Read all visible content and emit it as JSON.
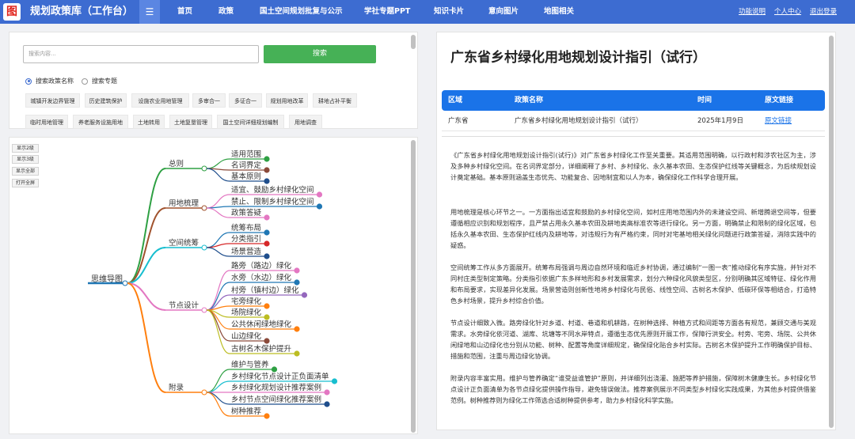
{
  "header": {
    "logo_glyph": "图",
    "app_title": "规划政策库（工作台）",
    "menu_glyph": "☰",
    "nav": [
      "首页",
      "政策",
      "国土空间规划批复与公示",
      "学社专题PPT",
      "知识卡片",
      "意向图片",
      "地图相关"
    ],
    "right_links": [
      "功能说明",
      "个人中心",
      "退出登录"
    ]
  },
  "search": {
    "placeholder": "搜索内容...",
    "button_label": "搜索",
    "radio_options": [
      "搜索政策名称",
      "搜索专题"
    ],
    "selected_radio": 0,
    "tags_row1": [
      "城镇开发边界管理",
      "历史建筑保护",
      "设施农业用地管理",
      "多审合一",
      "多证合一",
      "规划用地改革",
      "耕地占补平衡"
    ],
    "tags_row2": [
      "临时用地管理",
      "养老服务设施用地",
      "土地转用",
      "土地复垦管理",
      "国土空间详细规划编制",
      "用地调查"
    ]
  },
  "mindmap": {
    "controls": [
      "显示2级",
      "显示3级",
      "显示全部",
      "打开全屏"
    ],
    "root": "思维导图",
    "branches": [
      {
        "label": "总则",
        "color": "#2ea043",
        "children": [
          {
            "label": "适用范围",
            "color": "#2ea043"
          },
          {
            "label": "名词界定",
            "color": "#8b4a3a"
          },
          {
            "label": "基本原则",
            "color": "#1f4e8c"
          }
        ]
      },
      {
        "label": "用地梳理",
        "color": "#a0522d",
        "children": [
          {
            "label": "适宜、鼓励乡村绿化空间",
            "color": "#e377c2"
          },
          {
            "label": "禁止、限制乡村绿化空间",
            "color": "#1f77b4"
          },
          {
            "label": "政策答疑",
            "color": "#e377c2"
          }
        ]
      },
      {
        "label": "空间统筹",
        "color": "#17becf",
        "children": [
          {
            "label": "统筹布局",
            "color": "#1f77b4"
          },
          {
            "label": "分类指引",
            "color": "#d62728"
          },
          {
            "label": "场景营造",
            "color": "#1f4e8c"
          }
        ]
      },
      {
        "label": "节点设计",
        "color": "#e377c2",
        "children": [
          {
            "label": "路旁（路边）绿化",
            "color": "#e377c2"
          },
          {
            "label": "水旁（水边）绿化",
            "color": "#1f77b4"
          },
          {
            "label": "村旁（镇村边）绿化",
            "color": "#9467bd"
          },
          {
            "label": "宅旁绿化",
            "color": "#ff7f0e"
          },
          {
            "label": "场院绿化",
            "color": "#bcbd22"
          },
          {
            "label": "公共休闲绿地绿化",
            "color": "#ff7f0e"
          },
          {
            "label": "山边绿化",
            "color": "#8b4a3a"
          },
          {
            "label": "古树名木保护提升",
            "color": "#bcbd22"
          }
        ]
      },
      {
        "label": "附录",
        "color": "#ff7f0e",
        "children": [
          {
            "label": "维护与管养",
            "color": "#2ea043"
          },
          {
            "label": "乡村绿化节点设计正负面清单",
            "color": "#17becf"
          },
          {
            "label": "乡村绿化规划设计推荐案例",
            "color": "#e377c2"
          },
          {
            "label": "乡村节点空间绿化推荐案例",
            "color": "#1f4e8c"
          },
          {
            "label": "树种推荐",
            "color": "#ff7f0e"
          }
        ]
      }
    ]
  },
  "document": {
    "title": "广东省乡村绿化用地规划设计指引（试行）",
    "columns": [
      "区域",
      "政策名称",
      "时间",
      "原文链接"
    ],
    "row": {
      "region": "广东省",
      "name": "广东省乡村绿化用地规划设计指引（试行）",
      "date": "2025年1月9日",
      "link": "原文链接"
    },
    "paragraphs": [
      "《广东省乡村绿化用地规划设计指引(试行)》对广东省乡村绿化工作至关重要。其适用范围明确，以行政村和涉农社区为主，涉及多种乡村绿化空间。在名词界定部分，详细阐释了乡村、乡村绿化、永久基本农田、生态保护红线等关键概念，为后续规划设计奠定基础。基本原则涵盖生态优先、功能复合、因地制宜和以人为本，确保绿化工作科学合理开展。",
      "用地梳理是核心环节之一。一方面指出适宜和鼓励的乡村绿化空间，如村庄用地范围内外的未建设空间、新增腾退空间等，但要遵循相应识别和规划程序，且严禁占用永久基本农田及耕地类高标准农等进行绿化。另一方面，明确禁止和限制的绿化区域，包括永久基本农田、生态保护红线内及耕地等，对违规行为有严格约束，同时对宅基地相关绿化问题进行政策答疑，消除实践中的疑惑。",
      "空间统筹工作从多方面展开。统筹布局强调与周边自然环境和临近乡村协调，通过编制“一图一表”推动绿化有序实施，并针对不同村庄类型制定策略。分类指引依据广东多样地形和乡村发展需求，划分六种绿化风貌类型区，分别明确其区域特征、绿化作用和布局要求，实现差异化发展。场景营造则创新性地将乡村绿化与民俗、线性空间、古树名木保护、低碳环保等相结合，打造特色乡村场景，提升乡村综合价值。",
      "节点设计细致入微。路旁绿化针对乡道、村道、巷道和机耕路，在树种选择、种植方式和间距等方面各有规范，兼顾交通与美观需求。水旁绿化依河道、湖库、坑塘等不同水岸特点，遵循生态优先原则开展工作，保障行洪安全。村旁、宅旁、场院、公共休闲绿地和山边绿化也分别从功能、树种、配置等角度详细规定，确保绿化贴合乡村实际。古树名木保护提升工作明确保护目标、措施和范围，注重与周边绿化协调。",
      "附录内容丰富实用。维护与管养确定“谁受益谁管护”原则，并详细列出浇灌、施肥等养护措施，保障树木健康生长。乡村绿化节点设计正负面清单为各节点绿化提供操作指导，避免错误做法。推荐案例展示不同类型乡村绿化实践成果，为其他乡村提供借鉴范例。树种推荐则为绿化工作筛选合适树种提供参考，助力乡村绿化科学实施。"
    ]
  }
}
